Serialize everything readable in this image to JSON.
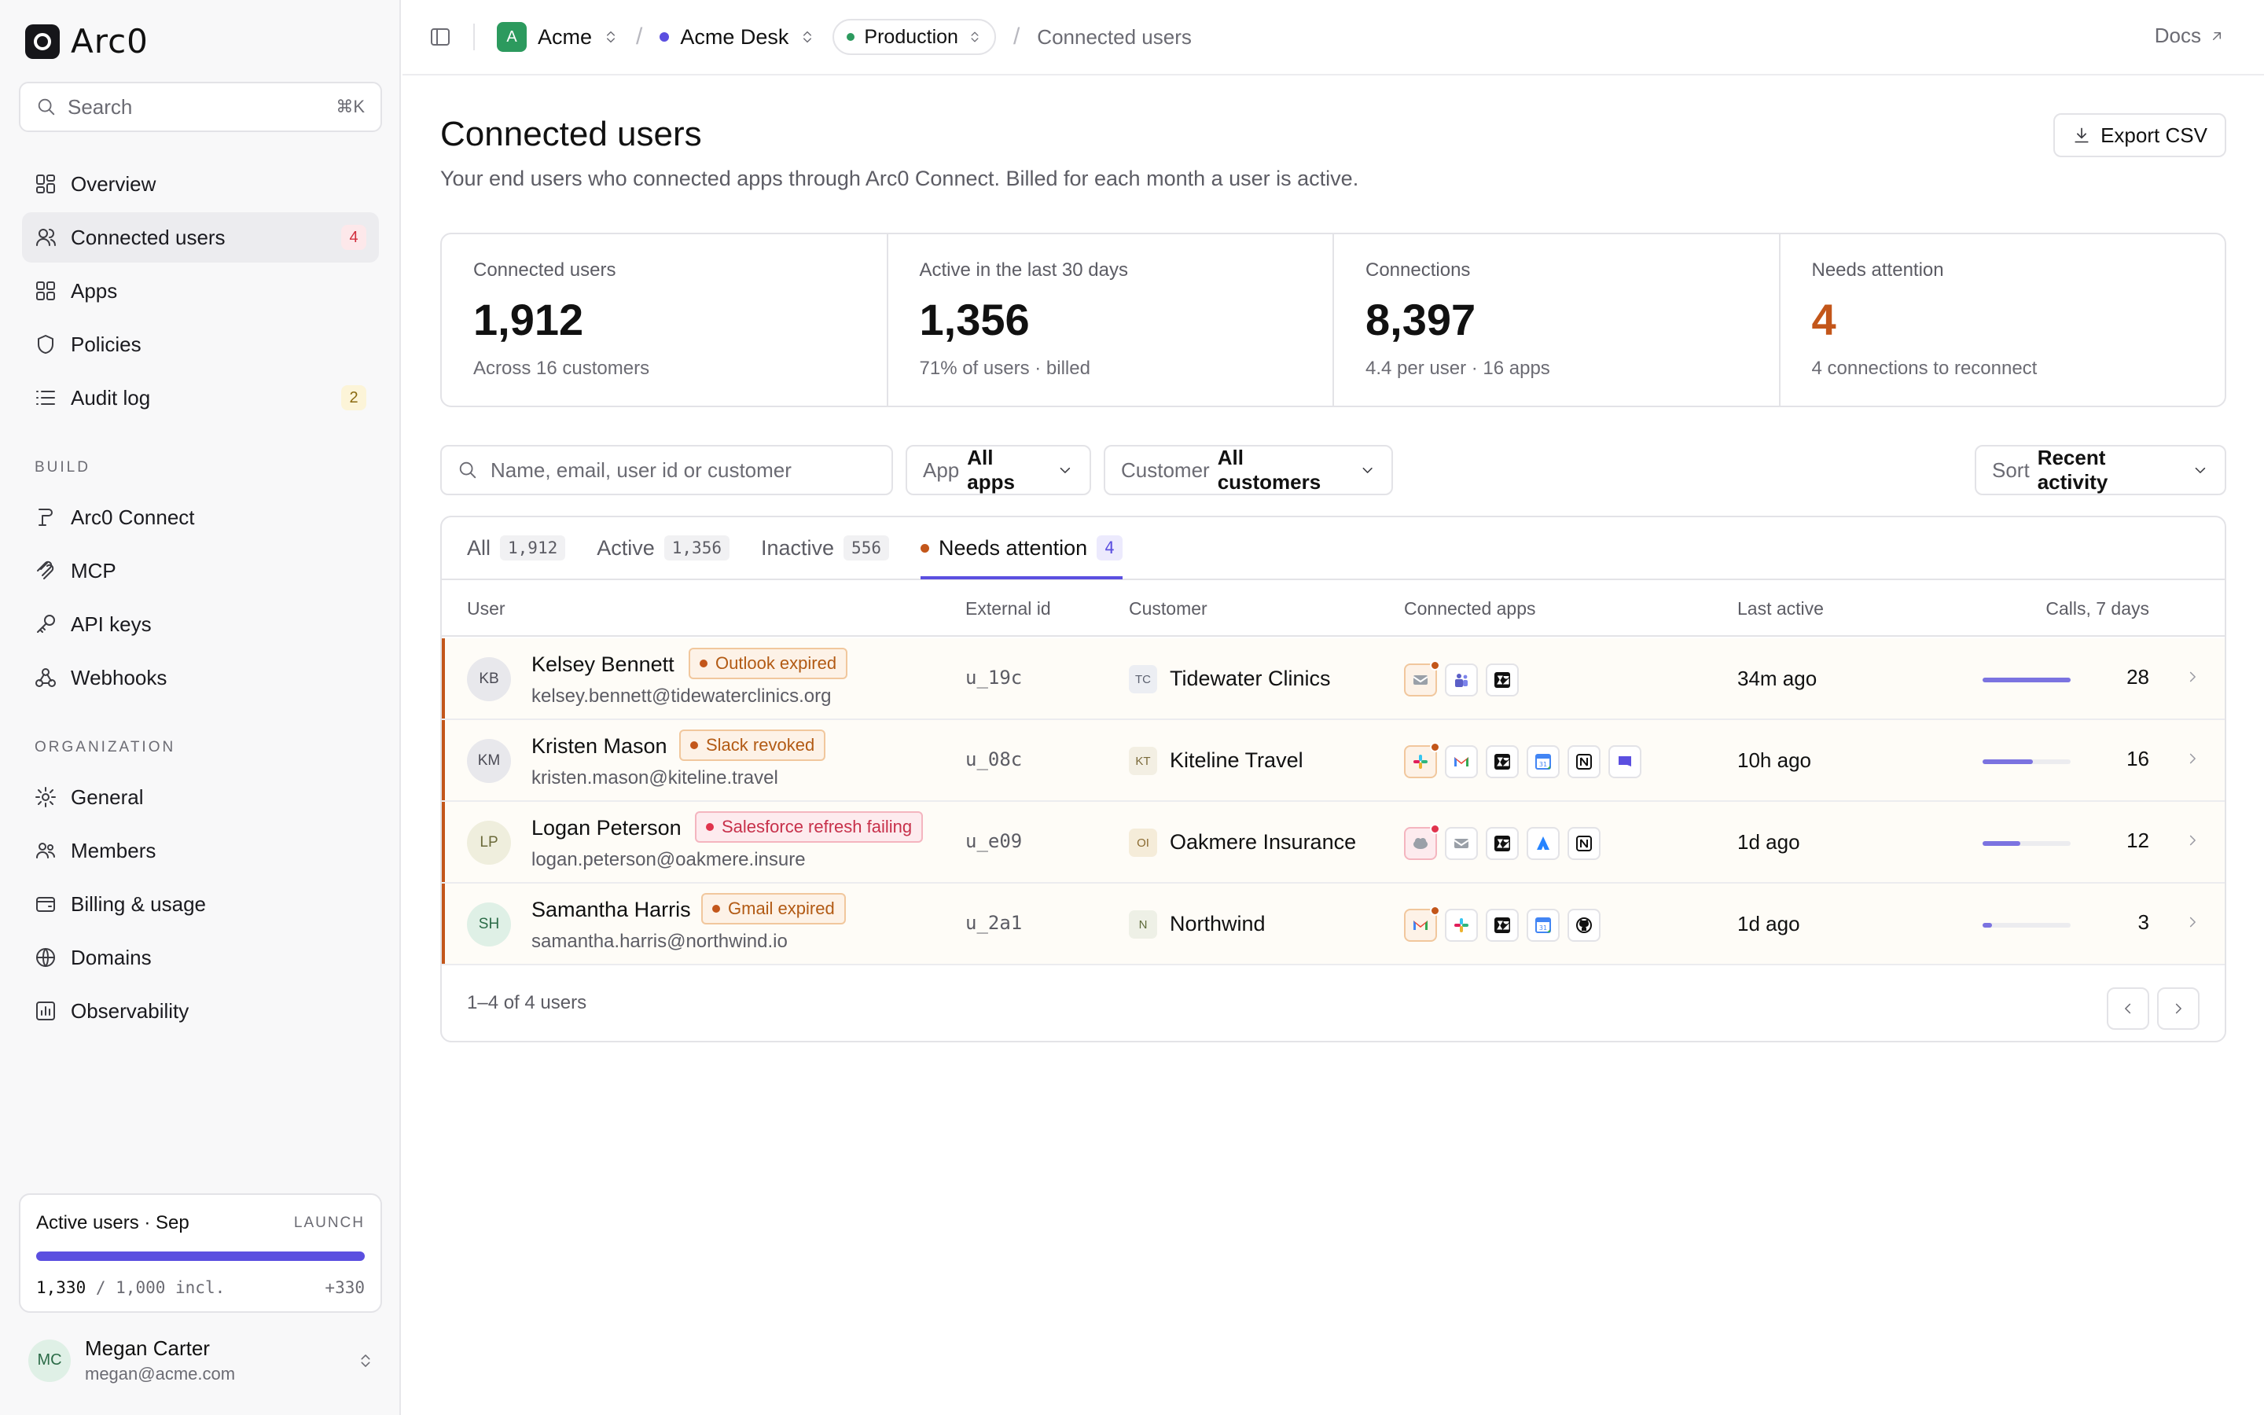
{
  "brand": {
    "name": "Arc0"
  },
  "search": {
    "placeholder": "Search",
    "shortcut": "⌘K"
  },
  "nav_main": [
    {
      "label": "Overview",
      "icon": "grid-icon"
    },
    {
      "label": "Connected users",
      "icon": "users-icon",
      "count": "4"
    },
    {
      "label": "Apps",
      "icon": "apps-icon"
    },
    {
      "label": "Policies",
      "icon": "shield-icon"
    },
    {
      "label": "Audit log",
      "icon": "list-icon",
      "count": "2"
    }
  ],
  "section_build": "BUILD",
  "nav_build": [
    {
      "label": "Arc0 Connect",
      "icon": "connect-icon"
    },
    {
      "label": "MCP",
      "icon": "mcp-icon"
    },
    {
      "label": "API keys",
      "icon": "key-icon"
    },
    {
      "label": "Webhooks",
      "icon": "webhook-icon"
    }
  ],
  "section_org": "ORGANIZATION",
  "nav_org": [
    {
      "label": "General",
      "icon": "gear-icon"
    },
    {
      "label": "Members",
      "icon": "members-icon"
    },
    {
      "label": "Billing & usage",
      "icon": "wallet-icon"
    },
    {
      "label": "Domains",
      "icon": "globe-icon"
    },
    {
      "label": "Observability",
      "icon": "chart-icon"
    }
  ],
  "usage": {
    "title": "Active users · Sep",
    "tag": "LAUNCH",
    "used": "1,330",
    "sep": " / ",
    "included": "1,000 incl.",
    "overage": "+330",
    "progress": 1.0
  },
  "profile": {
    "initials": "MC",
    "name": "Megan Carter",
    "email": "megan@acme.com"
  },
  "topbar": {
    "org_initial": "A",
    "org": "Acme",
    "project": "Acme Desk",
    "env": "Production",
    "page": "Connected users",
    "docs": "Docs"
  },
  "page": {
    "title": "Connected users",
    "subtitle": "Your end users who connected apps through Arc0 Connect. Billed for each month a user is active.",
    "export": "Export CSV"
  },
  "stats": [
    {
      "label": "Connected users",
      "value": "1,912",
      "note": "Across 16 customers"
    },
    {
      "label": "Active in the last 30 days",
      "value": "1,356",
      "note": "71% of users · billed"
    },
    {
      "label": "Connections",
      "value": "8,397",
      "note": "4.4 per user · 16 apps"
    },
    {
      "label": "Needs attention",
      "value": "4",
      "note": "4 connections to reconnect"
    }
  ],
  "filters": {
    "search_placeholder": "Name, email, user id or customer",
    "app_key": "App",
    "app_value": "All apps",
    "customer_key": "Customer",
    "customer_value": "All customers",
    "sort_key": "Sort",
    "sort_value": "Recent activity"
  },
  "tabs": [
    {
      "label": "All",
      "count": "1,912"
    },
    {
      "label": "Active",
      "count": "1,356"
    },
    {
      "label": "Inactive",
      "count": "556"
    },
    {
      "label": "Needs attention",
      "count": "4"
    }
  ],
  "columns": {
    "user": "User",
    "external": "External id",
    "customer": "Customer",
    "apps": "Connected apps",
    "last": "Last active",
    "calls": "Calls, 7 days"
  },
  "rows": [
    {
      "initials": "KB",
      "name": "Kelsey Bennett",
      "issue": "Outlook expired",
      "email": "kelsey.bennett@tidewaterclinics.org",
      "ext": "u_19c",
      "cust_initials": "TC",
      "customer": "Tidewater Clinics",
      "apps": [
        "outlook-icon",
        "teams-icon",
        "zendesk-icon"
      ],
      "last": "34m ago",
      "calls": "28",
      "calls_value": 28
    },
    {
      "initials": "KM",
      "name": "Kristen Mason",
      "issue": "Slack revoked",
      "email": "kristen.mason@kiteline.travel",
      "ext": "u_08c",
      "cust_initials": "KT",
      "customer": "Kiteline Travel",
      "apps": [
        "slack-icon",
        "gmail-icon",
        "zendesk-icon",
        "calendar-icon",
        "notion-icon",
        "intercom-icon"
      ],
      "last": "10h ago",
      "calls": "16",
      "calls_value": 16
    },
    {
      "initials": "LP",
      "name": "Logan Peterson",
      "issue": "Salesforce refresh failing",
      "email": "logan.peterson@oakmere.insure",
      "ext": "u_e09",
      "cust_initials": "OI",
      "customer": "Oakmere Insurance",
      "apps": [
        "salesforce-icon",
        "outlook-icon",
        "zendesk-icon",
        "atlassian-icon",
        "notion-icon"
      ],
      "last": "1d ago",
      "calls": "12",
      "calls_value": 12
    },
    {
      "initials": "SH",
      "name": "Samantha Harris",
      "issue": "Gmail expired",
      "email": "samantha.harris@northwind.io",
      "ext": "u_2a1",
      "cust_initials": "N",
      "customer": "Northwind",
      "apps": [
        "gmail-icon",
        "slack-icon",
        "zendesk-icon",
        "calendar-icon",
        "github-icon"
      ],
      "last": "1d ago",
      "calls": "3",
      "calls_value": 3
    }
  ],
  "footer": {
    "range": "1–4 of 4 users"
  },
  "colors": {
    "accent": "#5b4fe0",
    "warning": "#c3561a",
    "danger": "#d12f3d",
    "success": "#2c9a5e"
  }
}
